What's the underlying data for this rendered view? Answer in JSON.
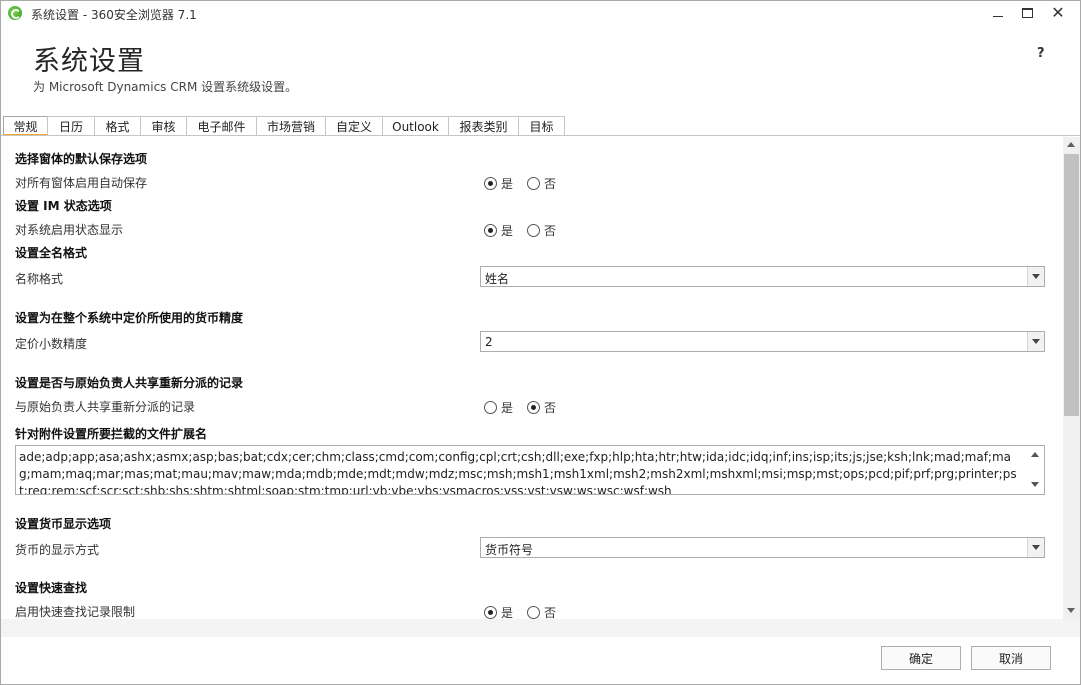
{
  "window": {
    "title": "系统设置 - 360安全浏览器 7.1",
    "minimize": "minimize-icon",
    "maximize": "maximize-icon",
    "close": "close-icon"
  },
  "header": {
    "title": "系统设置",
    "subtitle": "为 Microsoft Dynamics CRM 设置系统级设置。",
    "help": "?"
  },
  "tabs": [
    {
      "label": "常规",
      "active": true
    },
    {
      "label": "日历"
    },
    {
      "label": "格式"
    },
    {
      "label": "审核"
    },
    {
      "label": "电子邮件"
    },
    {
      "label": "市场营销"
    },
    {
      "label": "自定义"
    },
    {
      "label": "Outlook"
    },
    {
      "label": "报表类别"
    },
    {
      "label": "目标"
    }
  ],
  "sections": {
    "autosave": {
      "heading": "选择窗体的默认保存选项",
      "label": "对所有窗体启用自动保存",
      "yes": "是",
      "no": "否",
      "selected": "yes"
    },
    "im": {
      "heading": "设置 IM 状态选项",
      "label": "对系统启用状态显示",
      "yes": "是",
      "no": "否",
      "selected": "yes"
    },
    "fullname": {
      "heading": "设置全名格式",
      "label": "名称格式",
      "value": "姓名"
    },
    "currency_precision": {
      "heading": "设置为在整个系统中定价所使用的货币精度",
      "label": "定价小数精度",
      "value": "2"
    },
    "reassign": {
      "heading": "设置是否与原始负责人共享重新分派的记录",
      "label": "与原始负责人共享重新分派的记录",
      "yes": "是",
      "no": "否",
      "selected": "no"
    },
    "attachments": {
      "heading": "针对附件设置所要拦截的文件扩展名",
      "value": "ade;adp;app;asa;ashx;asmx;asp;bas;bat;cdx;cer;chm;class;cmd;com;config;cpl;crt;csh;dll;exe;fxp;hlp;hta;htr;htw;ida;idc;idq;inf;ins;isp;its;js;jse;ksh;lnk;mad;maf;mag;mam;maq;mar;mas;mat;mau;mav;maw;mda;mdb;mde;mdt;mdw;mdz;msc;msh;msh1;msh1xml;msh2;msh2xml;mshxml;msi;msp;mst;ops;pcd;pif;prf;prg;printer;pst;reg;rem;scf;scr;sct;shb;shs;shtm;shtml;soap;stm;tmp;url;vb;vbe;vbs;vsmacros;vss;vst;vsw;ws;wsc;wsf;wsh"
    },
    "currency_display": {
      "heading": "设置货币显示选项",
      "label": "货币的显示方式",
      "value": "货币符号"
    },
    "quickfind": {
      "heading": "设置快速查找",
      "label": "启用快速查找记录限制",
      "yes": "是",
      "no": "否",
      "selected": "yes"
    }
  },
  "footer": {
    "ok": "确定",
    "cancel": "取消"
  }
}
